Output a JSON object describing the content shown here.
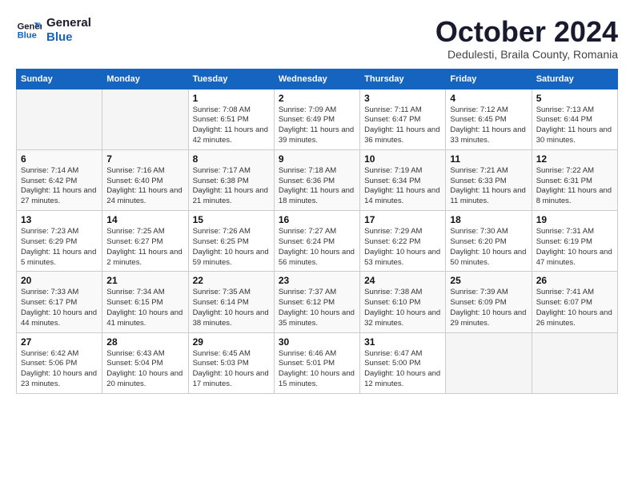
{
  "logo": {
    "line1": "General",
    "line2": "Blue"
  },
  "title": "October 2024",
  "location": "Dedulesti, Braila County, Romania",
  "days_of_week": [
    "Sunday",
    "Monday",
    "Tuesday",
    "Wednesday",
    "Thursday",
    "Friday",
    "Saturday"
  ],
  "weeks": [
    [
      {
        "num": "",
        "info": ""
      },
      {
        "num": "",
        "info": ""
      },
      {
        "num": "1",
        "info": "Sunrise: 7:08 AM\nSunset: 6:51 PM\nDaylight: 11 hours and 42 minutes."
      },
      {
        "num": "2",
        "info": "Sunrise: 7:09 AM\nSunset: 6:49 PM\nDaylight: 11 hours and 39 minutes."
      },
      {
        "num": "3",
        "info": "Sunrise: 7:11 AM\nSunset: 6:47 PM\nDaylight: 11 hours and 36 minutes."
      },
      {
        "num": "4",
        "info": "Sunrise: 7:12 AM\nSunset: 6:45 PM\nDaylight: 11 hours and 33 minutes."
      },
      {
        "num": "5",
        "info": "Sunrise: 7:13 AM\nSunset: 6:44 PM\nDaylight: 11 hours and 30 minutes."
      }
    ],
    [
      {
        "num": "6",
        "info": "Sunrise: 7:14 AM\nSunset: 6:42 PM\nDaylight: 11 hours and 27 minutes."
      },
      {
        "num": "7",
        "info": "Sunrise: 7:16 AM\nSunset: 6:40 PM\nDaylight: 11 hours and 24 minutes."
      },
      {
        "num": "8",
        "info": "Sunrise: 7:17 AM\nSunset: 6:38 PM\nDaylight: 11 hours and 21 minutes."
      },
      {
        "num": "9",
        "info": "Sunrise: 7:18 AM\nSunset: 6:36 PM\nDaylight: 11 hours and 18 minutes."
      },
      {
        "num": "10",
        "info": "Sunrise: 7:19 AM\nSunset: 6:34 PM\nDaylight: 11 hours and 14 minutes."
      },
      {
        "num": "11",
        "info": "Sunrise: 7:21 AM\nSunset: 6:33 PM\nDaylight: 11 hours and 11 minutes."
      },
      {
        "num": "12",
        "info": "Sunrise: 7:22 AM\nSunset: 6:31 PM\nDaylight: 11 hours and 8 minutes."
      }
    ],
    [
      {
        "num": "13",
        "info": "Sunrise: 7:23 AM\nSunset: 6:29 PM\nDaylight: 11 hours and 5 minutes."
      },
      {
        "num": "14",
        "info": "Sunrise: 7:25 AM\nSunset: 6:27 PM\nDaylight: 11 hours and 2 minutes."
      },
      {
        "num": "15",
        "info": "Sunrise: 7:26 AM\nSunset: 6:25 PM\nDaylight: 10 hours and 59 minutes."
      },
      {
        "num": "16",
        "info": "Sunrise: 7:27 AM\nSunset: 6:24 PM\nDaylight: 10 hours and 56 minutes."
      },
      {
        "num": "17",
        "info": "Sunrise: 7:29 AM\nSunset: 6:22 PM\nDaylight: 10 hours and 53 minutes."
      },
      {
        "num": "18",
        "info": "Sunrise: 7:30 AM\nSunset: 6:20 PM\nDaylight: 10 hours and 50 minutes."
      },
      {
        "num": "19",
        "info": "Sunrise: 7:31 AM\nSunset: 6:19 PM\nDaylight: 10 hours and 47 minutes."
      }
    ],
    [
      {
        "num": "20",
        "info": "Sunrise: 7:33 AM\nSunset: 6:17 PM\nDaylight: 10 hours and 44 minutes."
      },
      {
        "num": "21",
        "info": "Sunrise: 7:34 AM\nSunset: 6:15 PM\nDaylight: 10 hours and 41 minutes."
      },
      {
        "num": "22",
        "info": "Sunrise: 7:35 AM\nSunset: 6:14 PM\nDaylight: 10 hours and 38 minutes."
      },
      {
        "num": "23",
        "info": "Sunrise: 7:37 AM\nSunset: 6:12 PM\nDaylight: 10 hours and 35 minutes."
      },
      {
        "num": "24",
        "info": "Sunrise: 7:38 AM\nSunset: 6:10 PM\nDaylight: 10 hours and 32 minutes."
      },
      {
        "num": "25",
        "info": "Sunrise: 7:39 AM\nSunset: 6:09 PM\nDaylight: 10 hours and 29 minutes."
      },
      {
        "num": "26",
        "info": "Sunrise: 7:41 AM\nSunset: 6:07 PM\nDaylight: 10 hours and 26 minutes."
      }
    ],
    [
      {
        "num": "27",
        "info": "Sunrise: 6:42 AM\nSunset: 5:06 PM\nDaylight: 10 hours and 23 minutes."
      },
      {
        "num": "28",
        "info": "Sunrise: 6:43 AM\nSunset: 5:04 PM\nDaylight: 10 hours and 20 minutes."
      },
      {
        "num": "29",
        "info": "Sunrise: 6:45 AM\nSunset: 5:03 PM\nDaylight: 10 hours and 17 minutes."
      },
      {
        "num": "30",
        "info": "Sunrise: 6:46 AM\nSunset: 5:01 PM\nDaylight: 10 hours and 15 minutes."
      },
      {
        "num": "31",
        "info": "Sunrise: 6:47 AM\nSunset: 5:00 PM\nDaylight: 10 hours and 12 minutes."
      },
      {
        "num": "",
        "info": ""
      },
      {
        "num": "",
        "info": ""
      }
    ]
  ]
}
